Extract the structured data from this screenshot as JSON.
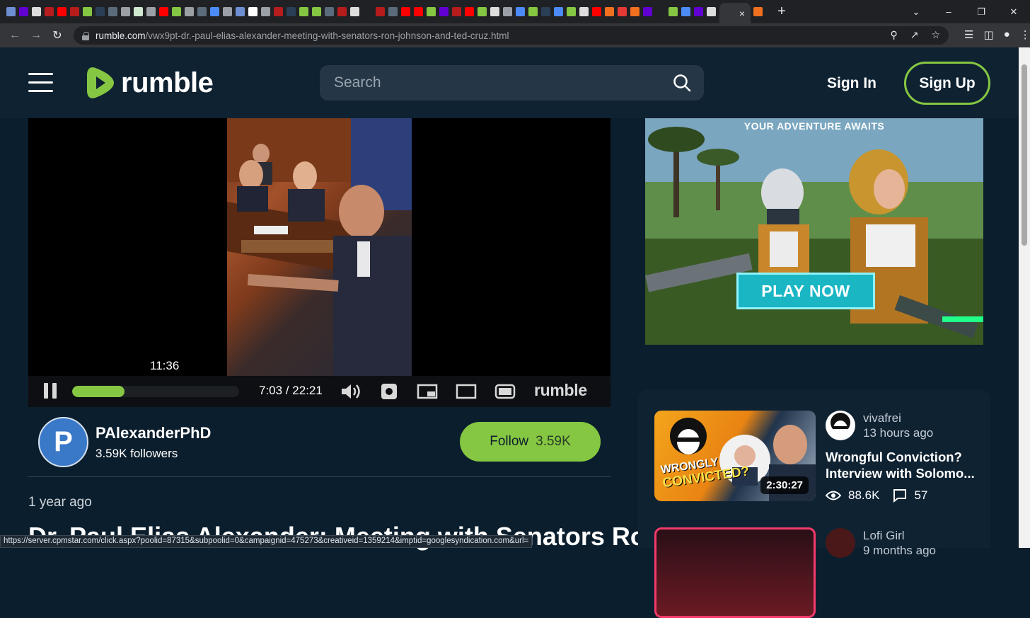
{
  "browser": {
    "tabs_favicons": [
      "#6d8fd1",
      "#6001d2",
      "#dddddd",
      "#b71c1c",
      "#ff0000",
      "#b71c1c",
      "#85c742",
      "#2a3f55",
      "#5a6b7c",
      "#9aa0a6",
      "#d0e8d0",
      "#9aa0a6",
      "#ff0000",
      "#85c742",
      "#9aa0a6",
      "#5a6b7c",
      "#4c8bf5",
      "#9aa0a6",
      "#6d8fd1",
      "#ffffff",
      "#9aa0a6",
      "#b71c1c",
      "#2a3f55",
      "#85c742",
      "#85c742",
      "#5a6b7c",
      "#b71c1c",
      "#dddddd",
      "#202124",
      "#b71c1c",
      "#5a6b7c",
      "#ff0000",
      "#ff0000",
      "#85c742",
      "#6001d2",
      "#b71c1c",
      "#ff0000",
      "#85c742",
      "#dddddd",
      "#9aa0a6",
      "#4c8bf5",
      "#85c742",
      "#2a3f55",
      "#4c8bf5",
      "#85c742",
      "#dddddd",
      "#ff0000",
      "#f07020",
      "#e53935",
      "#f07020",
      "#6001d2",
      "#202124",
      "#85c742",
      "#4c8bf5",
      "#6001d2",
      "#dddddd",
      "#f07020"
    ],
    "active_tab_close": "×",
    "new_tab": "+",
    "url_host": "rumble.com",
    "url_path": "/vwx9pt-dr.-paul-elias-alexander-meeting-with-senators-ron-johnson-and-ted-cruz.html",
    "status_url": "https://server.cpmstar.com/click.aspx?poolid=87315&subpoolid=0&campaignid=475273&creativeid=1359214&imptid=googlesyndication.com&url="
  },
  "header": {
    "logo_text": "rumble",
    "search_placeholder": "Search",
    "sign_in": "Sign In",
    "sign_up": "Sign Up",
    "accent_color": "#85c742"
  },
  "player": {
    "hover_time": "11:36",
    "time_readout": "7:03 / 22:21",
    "progress_fraction": 0.315,
    "brand": "rumble"
  },
  "channel": {
    "avatar_letter": "P",
    "name": "PAlexanderPhD",
    "followers": "3.59K followers",
    "follow_label": "Follow",
    "follow_count": "3.59K"
  },
  "video": {
    "published": "1 year ago",
    "title": "Dr. Paul Elias Alexander: Meeting with Senators Ron"
  },
  "ad": {
    "tagline": "YOUR ADVENTURE AWAITS",
    "cta": "PLAY NOW"
  },
  "related": [
    {
      "channel": "vivafrei",
      "time": "13 hours ago",
      "title": "Wrongful Conviction? Interview with Solomo...",
      "duration": "2:30:27",
      "thumb_text_1": "WRONGLY",
      "thumb_text_2": "CONVICTED?",
      "views": "88.6K",
      "comments": "57"
    },
    {
      "channel": "Lofi Girl",
      "time": "9 months ago"
    }
  ]
}
